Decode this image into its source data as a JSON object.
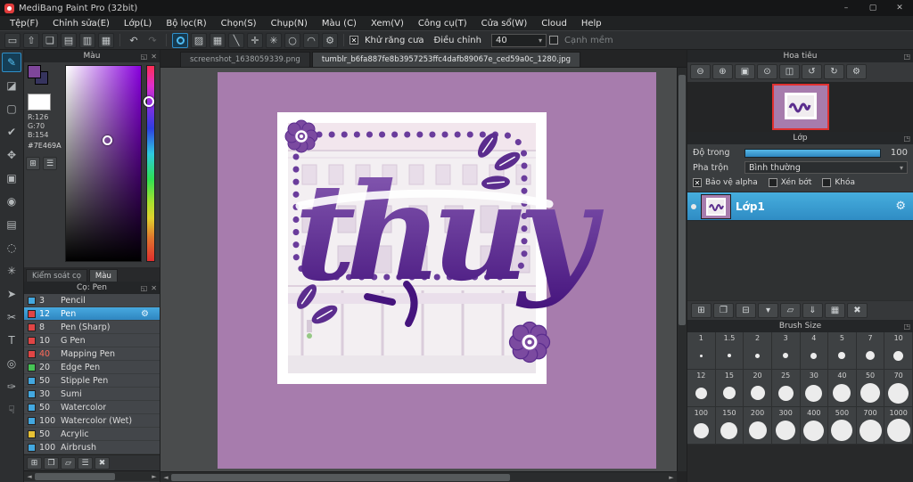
{
  "window": {
    "title": "MediBang Paint Pro (32bit)",
    "minimize": "–",
    "maximize": "▢",
    "close": "✕"
  },
  "menu": {
    "items": [
      {
        "label": "Tệp(F)",
        "name": "menu-file"
      },
      {
        "label": "Chỉnh sửa(E)",
        "name": "menu-edit"
      },
      {
        "label": "Lớp(L)",
        "name": "menu-layer"
      },
      {
        "label": "Bộ lọc(R)",
        "name": "menu-filter"
      },
      {
        "label": "Chọn(S)",
        "name": "menu-select"
      },
      {
        "label": "Chụp(N)",
        "name": "menu-snap"
      },
      {
        "label": "Màu (C)",
        "name": "menu-color"
      },
      {
        "label": "Xem(V)",
        "name": "menu-view"
      },
      {
        "label": "Công cụ(T)",
        "name": "menu-tools"
      },
      {
        "label": "Cửa sổ(W)",
        "name": "menu-window"
      },
      {
        "label": "Cloud",
        "name": "menu-cloud"
      },
      {
        "label": "Help",
        "name": "menu-help"
      }
    ]
  },
  "toolbar": {
    "left_icons": [
      {
        "glyph": "▭",
        "name": "workspace-icon"
      },
      {
        "glyph": "⇧",
        "name": "publish-icon"
      },
      {
        "glyph": "❏",
        "name": "comment-icon"
      },
      {
        "glyph": "▤",
        "name": "document-icon"
      },
      {
        "glyph": "▥",
        "name": "material-panel-icon"
      },
      {
        "glyph": "▦",
        "name": "grid-panel-icon"
      }
    ],
    "undo": "↶",
    "redo": "↷",
    "snap_icons": [
      {
        "glyph": "▨",
        "name": "tone-icon"
      },
      {
        "glyph": "▦",
        "name": "snap-grid-icon"
      },
      {
        "glyph": "╲",
        "name": "snap-parallel-icon"
      },
      {
        "glyph": "✛",
        "name": "snap-cross-icon"
      },
      {
        "glyph": "✳",
        "name": "snap-radial-icon"
      },
      {
        "glyph": "○",
        "name": "snap-circle-icon"
      },
      {
        "glyph": "◠",
        "name": "snap-curve-icon"
      },
      {
        "glyph": "⚙",
        "name": "snap-settings-icon"
      }
    ],
    "antialias_label": "Khử răng cưa",
    "adjust_label": "Điều chỉnh",
    "adjust_value": "40",
    "soft_edge_label": "Cạnh mềm",
    "dropdown_arrow": "▾"
  },
  "tools": [
    {
      "glyph": "✎",
      "name": "brush-tool",
      "selected": true
    },
    {
      "glyph": "◪",
      "name": "eraser-tool"
    },
    {
      "glyph": "▢",
      "name": "marquee-select-tool"
    },
    {
      "glyph": "✔",
      "name": "polyline-select-tool"
    },
    {
      "glyph": "✥",
      "name": "move-tool"
    },
    {
      "glyph": "▣",
      "name": "transform-tool"
    },
    {
      "glyph": "◉",
      "name": "bucket-fill-tool"
    },
    {
      "glyph": "▤",
      "name": "gradient-tool"
    },
    {
      "glyph": "◌",
      "name": "lasso-select-tool"
    },
    {
      "glyph": "✳",
      "name": "magic-wand-tool"
    },
    {
      "glyph": "➤",
      "name": "select-pen-tool"
    },
    {
      "glyph": "✂",
      "name": "divide-tool"
    },
    {
      "glyph": "T",
      "name": "text-tool"
    },
    {
      "glyph": "◎",
      "name": "zoom-tool"
    },
    {
      "glyph": "✑",
      "name": "script-brush-tool"
    },
    {
      "glyph": "☟",
      "name": "hand-tool"
    }
  ],
  "doc_tabs": [
    {
      "label": "screenshot_1638059339.png",
      "name": "tab-screenshot"
    },
    {
      "label": "tumblr_b6fa887fe8b3957253ffc4dafb89067e_ced59a0c_1280.jpg",
      "name": "tab-tumblr",
      "active": true
    }
  ],
  "color_panel": {
    "title": "Màu",
    "r": "R:126",
    "g": "G:70",
    "b": "B:154",
    "hex": "#7E469A",
    "fg_color": "#7E469A",
    "buttons": [
      {
        "glyph": "⊞",
        "name": "palette-grid-button"
      },
      {
        "glyph": "☰",
        "name": "color-sliders-button"
      }
    ],
    "tab_brush_control": "Kiểm soát cọ",
    "tab_color": "Màu"
  },
  "brush_panel": {
    "title": "Cọ: Pen",
    "brushes": [
      {
        "size": "3",
        "label": "Pencil",
        "color": "#43a8e0"
      },
      {
        "size": "12",
        "label": "Pen",
        "color": "#e04545",
        "selected": true
      },
      {
        "size": "8",
        "label": "Pen (Sharp)",
        "color": "#e04545"
      },
      {
        "size": "10",
        "label": "G Pen",
        "color": "#e04545"
      },
      {
        "size": "40",
        "label": "Mapping Pen",
        "color": "#e04545",
        "size_color": "#ff6a5a"
      },
      {
        "size": "20",
        "label": "Edge Pen",
        "color": "#46c455"
      },
      {
        "size": "50",
        "label": "Stipple Pen",
        "color": "#43a8e0"
      },
      {
        "size": "30",
        "label": "Sumi",
        "color": "#43a8e0"
      },
      {
        "size": "50",
        "label": "Watercolor",
        "color": "#43a8e0"
      },
      {
        "size": "100",
        "label": "Watercolor (Wet)",
        "color": "#43a8e0"
      },
      {
        "size": "50",
        "label": "Acrylic",
        "color": "#e8c235"
      },
      {
        "size": "100",
        "label": "Airbrush",
        "color": "#43a8e0"
      }
    ],
    "footer_buttons": [
      {
        "glyph": "⊞",
        "name": "new-brush-button"
      },
      {
        "glyph": "❐",
        "name": "duplicate-brush-button"
      },
      {
        "glyph": "▱",
        "name": "brush-folder-button"
      },
      {
        "glyph": "☰",
        "name": "brush-menu-button"
      },
      {
        "glyph": "✖",
        "name": "delete-brush-button"
      }
    ]
  },
  "navigator": {
    "title": "Hoa tiêu",
    "buttons": [
      {
        "glyph": "⊖",
        "name": "nav-zoom-out-button"
      },
      {
        "glyph": "⊕",
        "name": "nav-zoom-in-button"
      },
      {
        "glyph": "▣",
        "name": "nav-fit-screen-button"
      },
      {
        "glyph": "⊙",
        "name": "nav-actual-size-button"
      },
      {
        "glyph": "◫",
        "name": "nav-flip-button"
      },
      {
        "glyph": "↺",
        "name": "nav-rotate-left-button"
      },
      {
        "glyph": "↻",
        "name": "nav-rotate-right-button"
      },
      {
        "glyph": "⚙",
        "name": "nav-settings-button"
      }
    ]
  },
  "layer_panel": {
    "title": "Lớp",
    "opacity_label": "Độ trong",
    "opacity_value": "100",
    "blend_label": "Pha trộn",
    "blend_value": "Bình thường",
    "protect_alpha_label": "Bảo vệ alpha",
    "clipping_label": "Xén bớt",
    "lock_label": "Khóa",
    "layer_name": "Lớp1",
    "buttons": [
      {
        "glyph": "⊞",
        "name": "add-layer-button"
      },
      {
        "glyph": "❐",
        "name": "duplicate-layer-button"
      },
      {
        "glyph": "⊟",
        "name": "import-layer-button"
      },
      {
        "glyph": "▾",
        "name": "add-layer-menu-button"
      },
      {
        "glyph": "▱",
        "name": "add-folder-button"
      },
      {
        "glyph": "⇓",
        "name": "merge-layer-button"
      },
      {
        "glyph": "▦",
        "name": "combine-layer-button"
      },
      {
        "glyph": "✖",
        "name": "delete-layer-button"
      }
    ]
  },
  "brush_size_panel": {
    "title": "Brush Size",
    "sizes": [
      {
        "label": "1",
        "d": 3
      },
      {
        "label": "1.5",
        "d": 4
      },
      {
        "label": "2",
        "d": 5
      },
      {
        "label": "3",
        "d": 6
      },
      {
        "label": "4",
        "d": 7
      },
      {
        "label": "5",
        "d": 8
      },
      {
        "label": "7",
        "d": 10
      },
      {
        "label": "10",
        "d": 11
      },
      {
        "label": "12",
        "d": 13
      },
      {
        "label": "15",
        "d": 14
      },
      {
        "label": "20",
        "d": 16
      },
      {
        "label": "25",
        "d": 17
      },
      {
        "label": "30",
        "d": 19
      },
      {
        "label": "40",
        "d": 20
      },
      {
        "label": "50",
        "d": 22
      },
      {
        "label": "70",
        "d": 23
      },
      {
        "label": "100",
        "d": 17
      },
      {
        "label": "150",
        "d": 19
      },
      {
        "label": "200",
        "d": 20
      },
      {
        "label": "300",
        "d": 22
      },
      {
        "label": "400",
        "d": 23
      },
      {
        "label": "500",
        "d": 24
      },
      {
        "label": "700",
        "d": 25
      },
      {
        "label": "1000",
        "d": 26
      }
    ]
  },
  "artwork": {
    "lettering": "thuy",
    "background_color": "#a77cad",
    "ink_color": "#45147d"
  }
}
